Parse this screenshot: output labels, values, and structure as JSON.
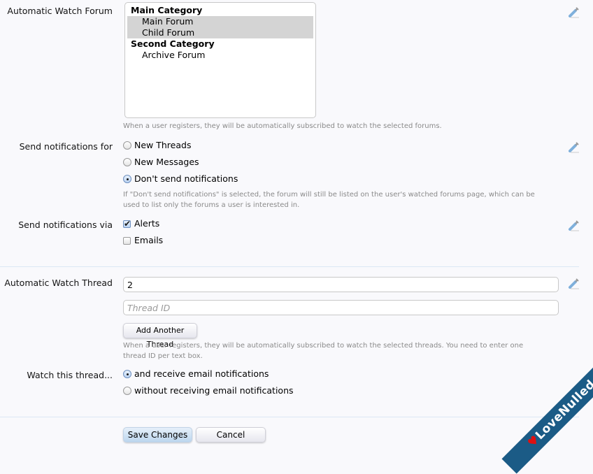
{
  "watch_forum": {
    "label": "Automatic Watch Forum",
    "options": [
      {
        "label": "Main Category",
        "type": "category",
        "selected": false
      },
      {
        "label": "Main Forum",
        "type": "forum",
        "selected": true
      },
      {
        "label": "Child Forum",
        "type": "forum",
        "selected": true
      },
      {
        "label": "Second Category",
        "type": "category",
        "selected": false
      },
      {
        "label": "Archive Forum",
        "type": "forum",
        "selected": false
      }
    ],
    "hint": "When a user registers, they will be automatically subscribed to watch the selected forums."
  },
  "notify_for": {
    "label": "Send notifications for",
    "options": [
      {
        "label": "New Threads",
        "checked": false
      },
      {
        "label": "New Messages",
        "checked": false
      },
      {
        "label": "Don't send notifications",
        "checked": true
      }
    ],
    "hint": "If \"Don't send notifications\" is selected, the forum will still be listed on the user's watched forums page, which can be used to list only the forums a user is interested in."
  },
  "notify_via": {
    "label": "Send notifications via",
    "options": [
      {
        "label": "Alerts",
        "checked": true
      },
      {
        "label": "Emails",
        "checked": false
      }
    ]
  },
  "watch_thread": {
    "label": "Automatic Watch Thread",
    "inputs": [
      {
        "value": "2",
        "placeholder": "Thread ID"
      },
      {
        "value": "",
        "placeholder": "Thread ID"
      }
    ],
    "add_button": "Add Another Thread",
    "hint": "When a user registers, they will be automatically subscribed to watch the selected threads. You need to enter one thread ID per text box."
  },
  "watch_mode": {
    "label": "Watch this thread...",
    "options": [
      {
        "label": "and receive email notifications",
        "checked": true
      },
      {
        "label": "without receiving email notifications",
        "checked": false
      }
    ]
  },
  "actions": {
    "save": "Save Changes",
    "cancel": "Cancel"
  },
  "watermark": {
    "text": "LoveNulled.com",
    "bg_color": "#1b5b86"
  }
}
